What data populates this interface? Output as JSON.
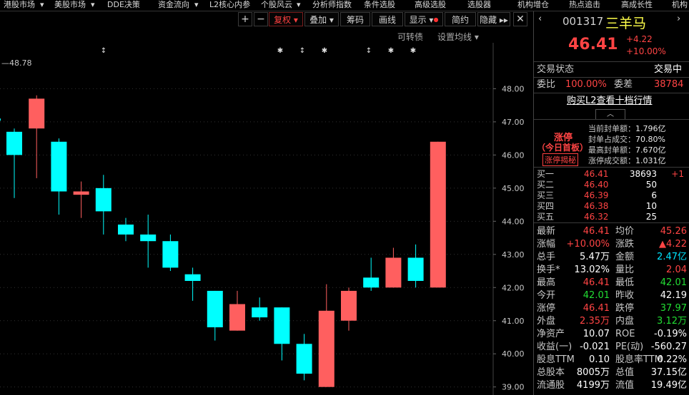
{
  "menu": [
    "港股市场",
    "美股市场",
    "DDE决策",
    "资金流向",
    "L2核心内参",
    "个股风云",
    "分析师指数",
    "条件选股",
    "高级选股",
    "选股器",
    "机构增仓",
    "热点追击",
    "高成长性",
    "机构"
  ],
  "toolbar": {
    "plus": "+",
    "minus": "−",
    "fuquan": "复权",
    "diejia": "叠加",
    "chouma": "筹码",
    "huaxian": "画线",
    "xianshi": "显示",
    "jianyue": "简约",
    "yincang": "隐藏"
  },
  "sublinks": {
    "convertible": "可转债",
    "set_ma": "设置均线"
  },
  "chart": {
    "top_label": "—48.78",
    "marker_symbols": [
      "↕",
      "✱",
      "↕",
      "✱",
      "↕",
      "✱",
      "✱"
    ],
    "price_ticks": [
      "48.00",
      "47.00",
      "46.00",
      "45.00",
      "44.00",
      "43.00",
      "42.00",
      "41.00",
      "40.00",
      "39.00"
    ]
  },
  "chart_data": {
    "type": "candlestick",
    "ylim": [
      38.8,
      49.3
    ],
    "ticks": [
      48,
      47,
      46,
      45,
      44,
      43,
      42,
      41,
      40,
      39
    ],
    "candles": [
      {
        "o": 46.7,
        "c": 46.0,
        "h": 46.8,
        "l": 44.7
      },
      {
        "o": 46.8,
        "c": 47.7,
        "h": 47.8,
        "l": 45.3
      },
      {
        "o": 46.4,
        "c": 44.9,
        "h": 46.5,
        "l": 44.2
      },
      {
        "o": 44.8,
        "c": 44.9,
        "h": 45.2,
        "l": 44.1
      },
      {
        "o": 45.0,
        "c": 44.3,
        "h": 45.4,
        "l": 43.6
      },
      {
        "o": 43.9,
        "c": 43.6,
        "h": 44.1,
        "l": 43.4
      },
      {
        "o": 43.6,
        "c": 43.4,
        "h": 44.2,
        "l": 42.6
      },
      {
        "o": 43.4,
        "c": 42.6,
        "h": 43.6,
        "l": 42.5
      },
      {
        "o": 42.4,
        "c": 42.2,
        "h": 42.6,
        "l": 41.6
      },
      {
        "o": 41.9,
        "c": 40.8,
        "h": 41.9,
        "l": 40.4
      },
      {
        "o": 40.7,
        "c": 41.5,
        "h": 41.9,
        "l": 40.7
      },
      {
        "o": 41.4,
        "c": 41.1,
        "h": 41.7,
        "l": 41.0
      },
      {
        "o": 41.4,
        "c": 40.3,
        "h": 41.4,
        "l": 39.8
      },
      {
        "o": 40.3,
        "c": 39.4,
        "h": 40.6,
        "l": 39.2
      },
      {
        "o": 39.0,
        "c": 41.3,
        "h": 42.1,
        "l": 39.0
      },
      {
        "o": 41.0,
        "c": 41.9,
        "h": 42.0,
        "l": 40.7
      },
      {
        "o": 42.3,
        "c": 42.0,
        "h": 42.9,
        "l": 41.9
      },
      {
        "o": 42.0,
        "c": 42.9,
        "h": 43.2,
        "l": 42.0
      },
      {
        "o": 42.9,
        "c": 42.2,
        "h": 43.3,
        "l": 42.0
      },
      {
        "o": 42.0,
        "c": 46.4,
        "h": 46.4,
        "l": 42.0
      }
    ]
  },
  "stock": {
    "code": "001317",
    "name": "三羊马",
    "price": "46.41",
    "change": "+4.22",
    "change_pct": "+10.00%"
  },
  "status": {
    "label": "交易状态",
    "value": "交易中"
  },
  "weibi": {
    "label1": "委比",
    "value1": "100.00%",
    "label2": "委差",
    "value2": "38784"
  },
  "l2_link": "购买L2查看十档行情",
  "limit": {
    "title": "涨停",
    "subtitle": "（今日首板）",
    "reveal_btn": "涨停揭秘",
    "lines": [
      {
        "label": "当前封单额：",
        "value": "1.796亿"
      },
      {
        "label": "封单占成交：",
        "value": "70.80%"
      },
      {
        "label": "最高封单额：",
        "value": "7.670亿"
      },
      {
        "label": "涨停成交额：",
        "value": "1.031亿"
      }
    ]
  },
  "bids": [
    {
      "label": "买一",
      "price": "46.41",
      "vol": "38693",
      "delta": "+1"
    },
    {
      "label": "买二",
      "price": "46.40",
      "vol": "50",
      "delta": ""
    },
    {
      "label": "买三",
      "price": "46.39",
      "vol": "6",
      "delta": ""
    },
    {
      "label": "买四",
      "price": "46.38",
      "vol": "10",
      "delta": ""
    },
    {
      "label": "买五",
      "price": "46.32",
      "vol": "25",
      "delta": ""
    }
  ],
  "stats": [
    {
      "l1": "最新",
      "v1": "46.41",
      "c1": "red",
      "l2": "均价",
      "v2": "45.26",
      "c2": "red"
    },
    {
      "l1": "涨幅",
      "v1": "+10.00%",
      "c1": "red",
      "l2": "涨跌",
      "v2": "▲4.22",
      "c2": "red"
    },
    {
      "l1": "总手",
      "v1": "5.47万",
      "c1": "white",
      "l2": "金额",
      "v2": "2.47亿",
      "c2": "cyan"
    },
    {
      "l1": "换手*",
      "v1": "13.02%",
      "c1": "white",
      "l2": "量比",
      "v2": "2.04",
      "c2": "red"
    },
    {
      "l1": "最高",
      "v1": "46.41",
      "c1": "red",
      "l2": "最低",
      "v2": "42.01",
      "c2": "green"
    },
    {
      "l1": "今开",
      "v1": "42.01",
      "c1": "green",
      "l2": "昨收",
      "v2": "42.19",
      "c2": "white"
    },
    {
      "l1": "涨停",
      "v1": "46.41",
      "c1": "red",
      "l2": "跌停",
      "v2": "37.97",
      "c2": "green"
    },
    {
      "l1": "外盘",
      "v1": "2.35万",
      "c1": "red",
      "l2": "内盘",
      "v2": "3.12万",
      "c2": "green"
    },
    {
      "l1": "净资产",
      "v1": "10.07",
      "c1": "white",
      "l2": "ROE",
      "v2": "-0.19%",
      "c2": "white"
    },
    {
      "l1": "收益(一)",
      "v1": "-0.021",
      "c1": "white",
      "l2": "PE(动)",
      "v2": "-560.27",
      "c2": "white"
    },
    {
      "l1": "股息TTM",
      "v1": "0.10",
      "c1": "white",
      "l2": "股息率TTM",
      "v2": "0.22%",
      "c2": "white"
    },
    {
      "l1": "总股本",
      "v1": "8005万",
      "c1": "white",
      "l2": "总值",
      "v2": "37.15亿",
      "c2": "white"
    },
    {
      "l1": "流通股",
      "v1": "4199万",
      "c1": "white",
      "l2": "流值",
      "v2": "19.49亿",
      "c2": "white"
    }
  ],
  "colors": {
    "up": "#ff5f5f",
    "down": "#00ffff",
    "grid": "#333333"
  }
}
